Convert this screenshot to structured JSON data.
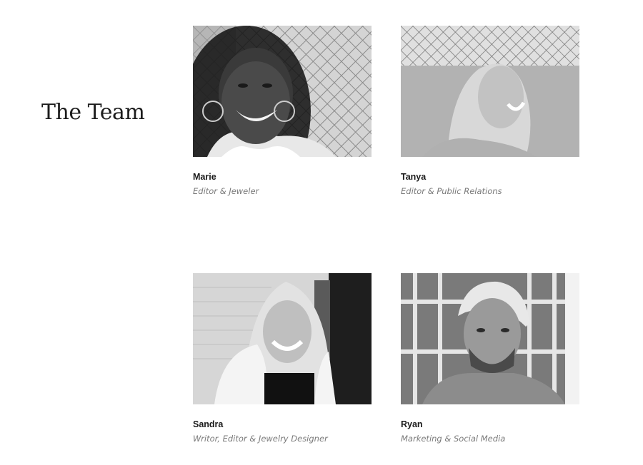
{
  "section": {
    "title": "The Team"
  },
  "members": [
    {
      "name": "Marie",
      "role": "Editor & Jeweler"
    },
    {
      "name": "Tanya",
      "role": "Editor & Public Relations"
    },
    {
      "name": "Sandra",
      "role": "Writor, Editor & Jewelry Designer"
    },
    {
      "name": "Ryan",
      "role": "Marketing & Social Media"
    }
  ]
}
